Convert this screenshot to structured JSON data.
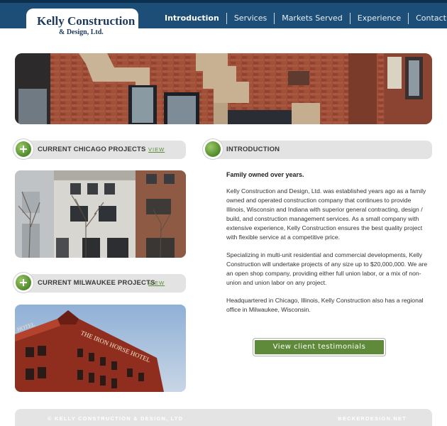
{
  "header": {
    "logo_name": "Kelly Construction",
    "logo_sub": "& Design, Ltd."
  },
  "nav": {
    "items": [
      "Introduction",
      "Services",
      "Markets Served",
      "Experience",
      "Contact"
    ],
    "active": "Introduction"
  },
  "left": {
    "chicago_title": "CURRENT CHICAGO PROJECTS",
    "chicago_view": "VIEW",
    "milwaukee_title": "CURRENT MILWAUKEE PROJECTS",
    "milwaukee_view": "VIEW",
    "milwaukee_sign": "THE IRON HORSE HOTEL",
    "milwaukee_sign2": "HOTEL"
  },
  "intro": {
    "section_title": "INTRODUCTION",
    "heading": "Family owned over years.",
    "p1": "Kelly Construction and Design, Ltd. was established years ago as a family owned and operated construction company that continues to provide Illinois, Wisconsin and Indiana with superior general contracting, design / build, and construction management services. As a small company with extensive experience, Kelly Construction ensures the best quality project with flexible service at a competitive price.",
    "p2": "Specializing in multi-unit residential and commercial developments, Kelly Construction will undertake projects of any size up to $20,000,000. We are an open shop company, providing either full union labor, or a mix of non-union and union labor on any project.",
    "p3": "Headquartered in Chicago, Illinois, Kelly Construction also has a regional office in Milwaukee, Wisconsin.",
    "button": "View client testimonials"
  },
  "footer": {
    "left": "© KELLY CONSTRUCTION & DESIGN, LTD",
    "right": "BECKERDESIGN.NET"
  },
  "colors": {
    "header_blue": "#1d4e78",
    "accent_green": "#5e8a3a",
    "pill_gray": "#e3e3e3"
  }
}
